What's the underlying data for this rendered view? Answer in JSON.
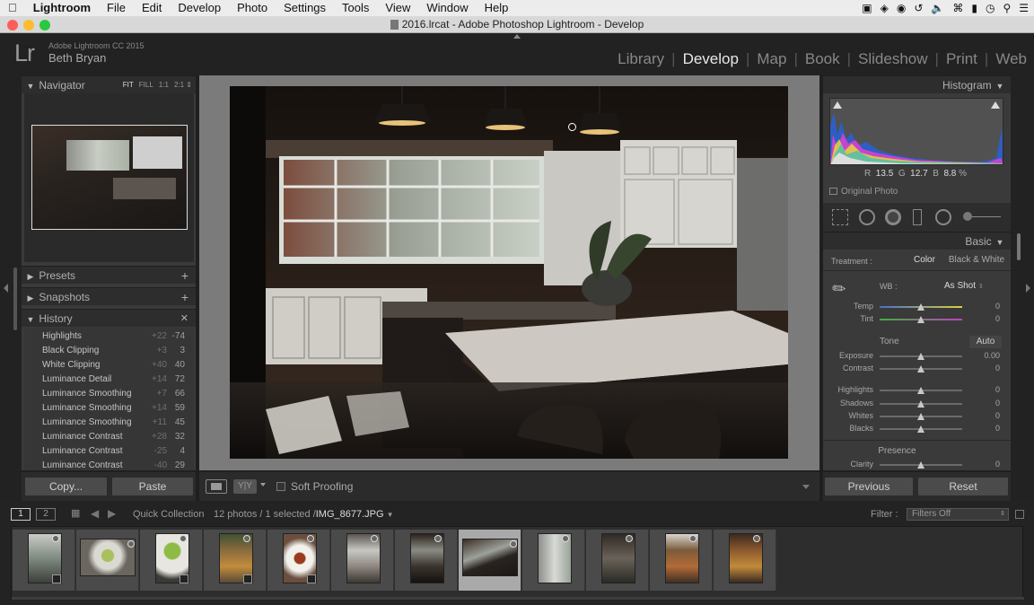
{
  "menubar": {
    "app": "Lightroom",
    "items": [
      "File",
      "Edit",
      "Develop",
      "Photo",
      "Settings",
      "Tools",
      "View",
      "Window",
      "Help"
    ]
  },
  "window": {
    "title": "2016.lrcat - Adobe Photoshop Lightroom - Develop"
  },
  "identity": {
    "product": "Adobe Lightroom CC 2015",
    "user": "Beth Bryan",
    "logo": "Lr"
  },
  "modules": [
    "Library",
    "Develop",
    "Map",
    "Book",
    "Slideshow",
    "Print",
    "Web"
  ],
  "active_module": "Develop",
  "left": {
    "navigator": {
      "title": "Navigator",
      "zoom": [
        "FIT",
        "FILL",
        "1:1",
        "2:1"
      ]
    },
    "presets": "Presets",
    "snapshots": "Snapshots",
    "history": {
      "title": "History",
      "rows": [
        {
          "name": "Highlights",
          "delta": "+22",
          "value": "-74"
        },
        {
          "name": "Black Clipping",
          "delta": "+3",
          "value": "3"
        },
        {
          "name": "White Clipping",
          "delta": "+40",
          "value": "40"
        },
        {
          "name": "Luminance Detail",
          "delta": "+14",
          "value": "72"
        },
        {
          "name": "Luminance Smoothing",
          "delta": "+7",
          "value": "66"
        },
        {
          "name": "Luminance Smoothing",
          "delta": "+14",
          "value": "59"
        },
        {
          "name": "Luminance Smoothing",
          "delta": "+11",
          "value": "45"
        },
        {
          "name": "Luminance Contrast",
          "delta": "+28",
          "value": "32"
        },
        {
          "name": "Luminance Contrast",
          "delta": "-25",
          "value": "4"
        },
        {
          "name": "Luminance Contrast",
          "delta": "-40",
          "value": "29"
        }
      ]
    },
    "copy_label": "Copy...",
    "paste_label": "Paste"
  },
  "toolbar": {
    "soft_proofing": "Soft Proofing"
  },
  "right": {
    "histogram": {
      "title": "Histogram",
      "r_label": "R",
      "r": "13.5",
      "g_label": "G",
      "g": "12.7",
      "b_label": "B",
      "b": "8.8",
      "unit": "%",
      "original_photo": "Original Photo"
    },
    "basic": {
      "title": "Basic",
      "treatment_label": "Treatment :",
      "treatment_color": "Color",
      "treatment_bw": "Black & White",
      "wb_label": "WB :",
      "wb_value": "As Shot",
      "tone_label": "Tone",
      "auto_label": "Auto",
      "presence_label": "Presence",
      "sliders": [
        {
          "label": "Temp",
          "value": "0",
          "position": 0.5
        },
        {
          "label": "Tint",
          "value": "0",
          "position": 0.5
        },
        {
          "label": "Exposure",
          "value": "0.00",
          "position": 0.5
        },
        {
          "label": "Contrast",
          "value": "0",
          "position": 0.5
        },
        {
          "label": "Highlights",
          "value": "0",
          "position": 0.5
        },
        {
          "label": "Shadows",
          "value": "0",
          "position": 0.5
        },
        {
          "label": "Whites",
          "value": "0",
          "position": 0.5
        },
        {
          "label": "Blacks",
          "value": "0",
          "position": 0.5
        },
        {
          "label": "Clarity",
          "value": "0",
          "position": 0.5
        }
      ]
    },
    "previous_label": "Previous",
    "reset_label": "Reset"
  },
  "filmbar": {
    "page1": "1",
    "page2": "2",
    "source": "Quick Collection",
    "count": "12 photos / 1 selected /",
    "filename": "IMG_8677.JPG",
    "filter_label": "Filter :",
    "filter_value": "Filters Off"
  },
  "filmstrip": {
    "count": 12,
    "selected_index": 7
  }
}
